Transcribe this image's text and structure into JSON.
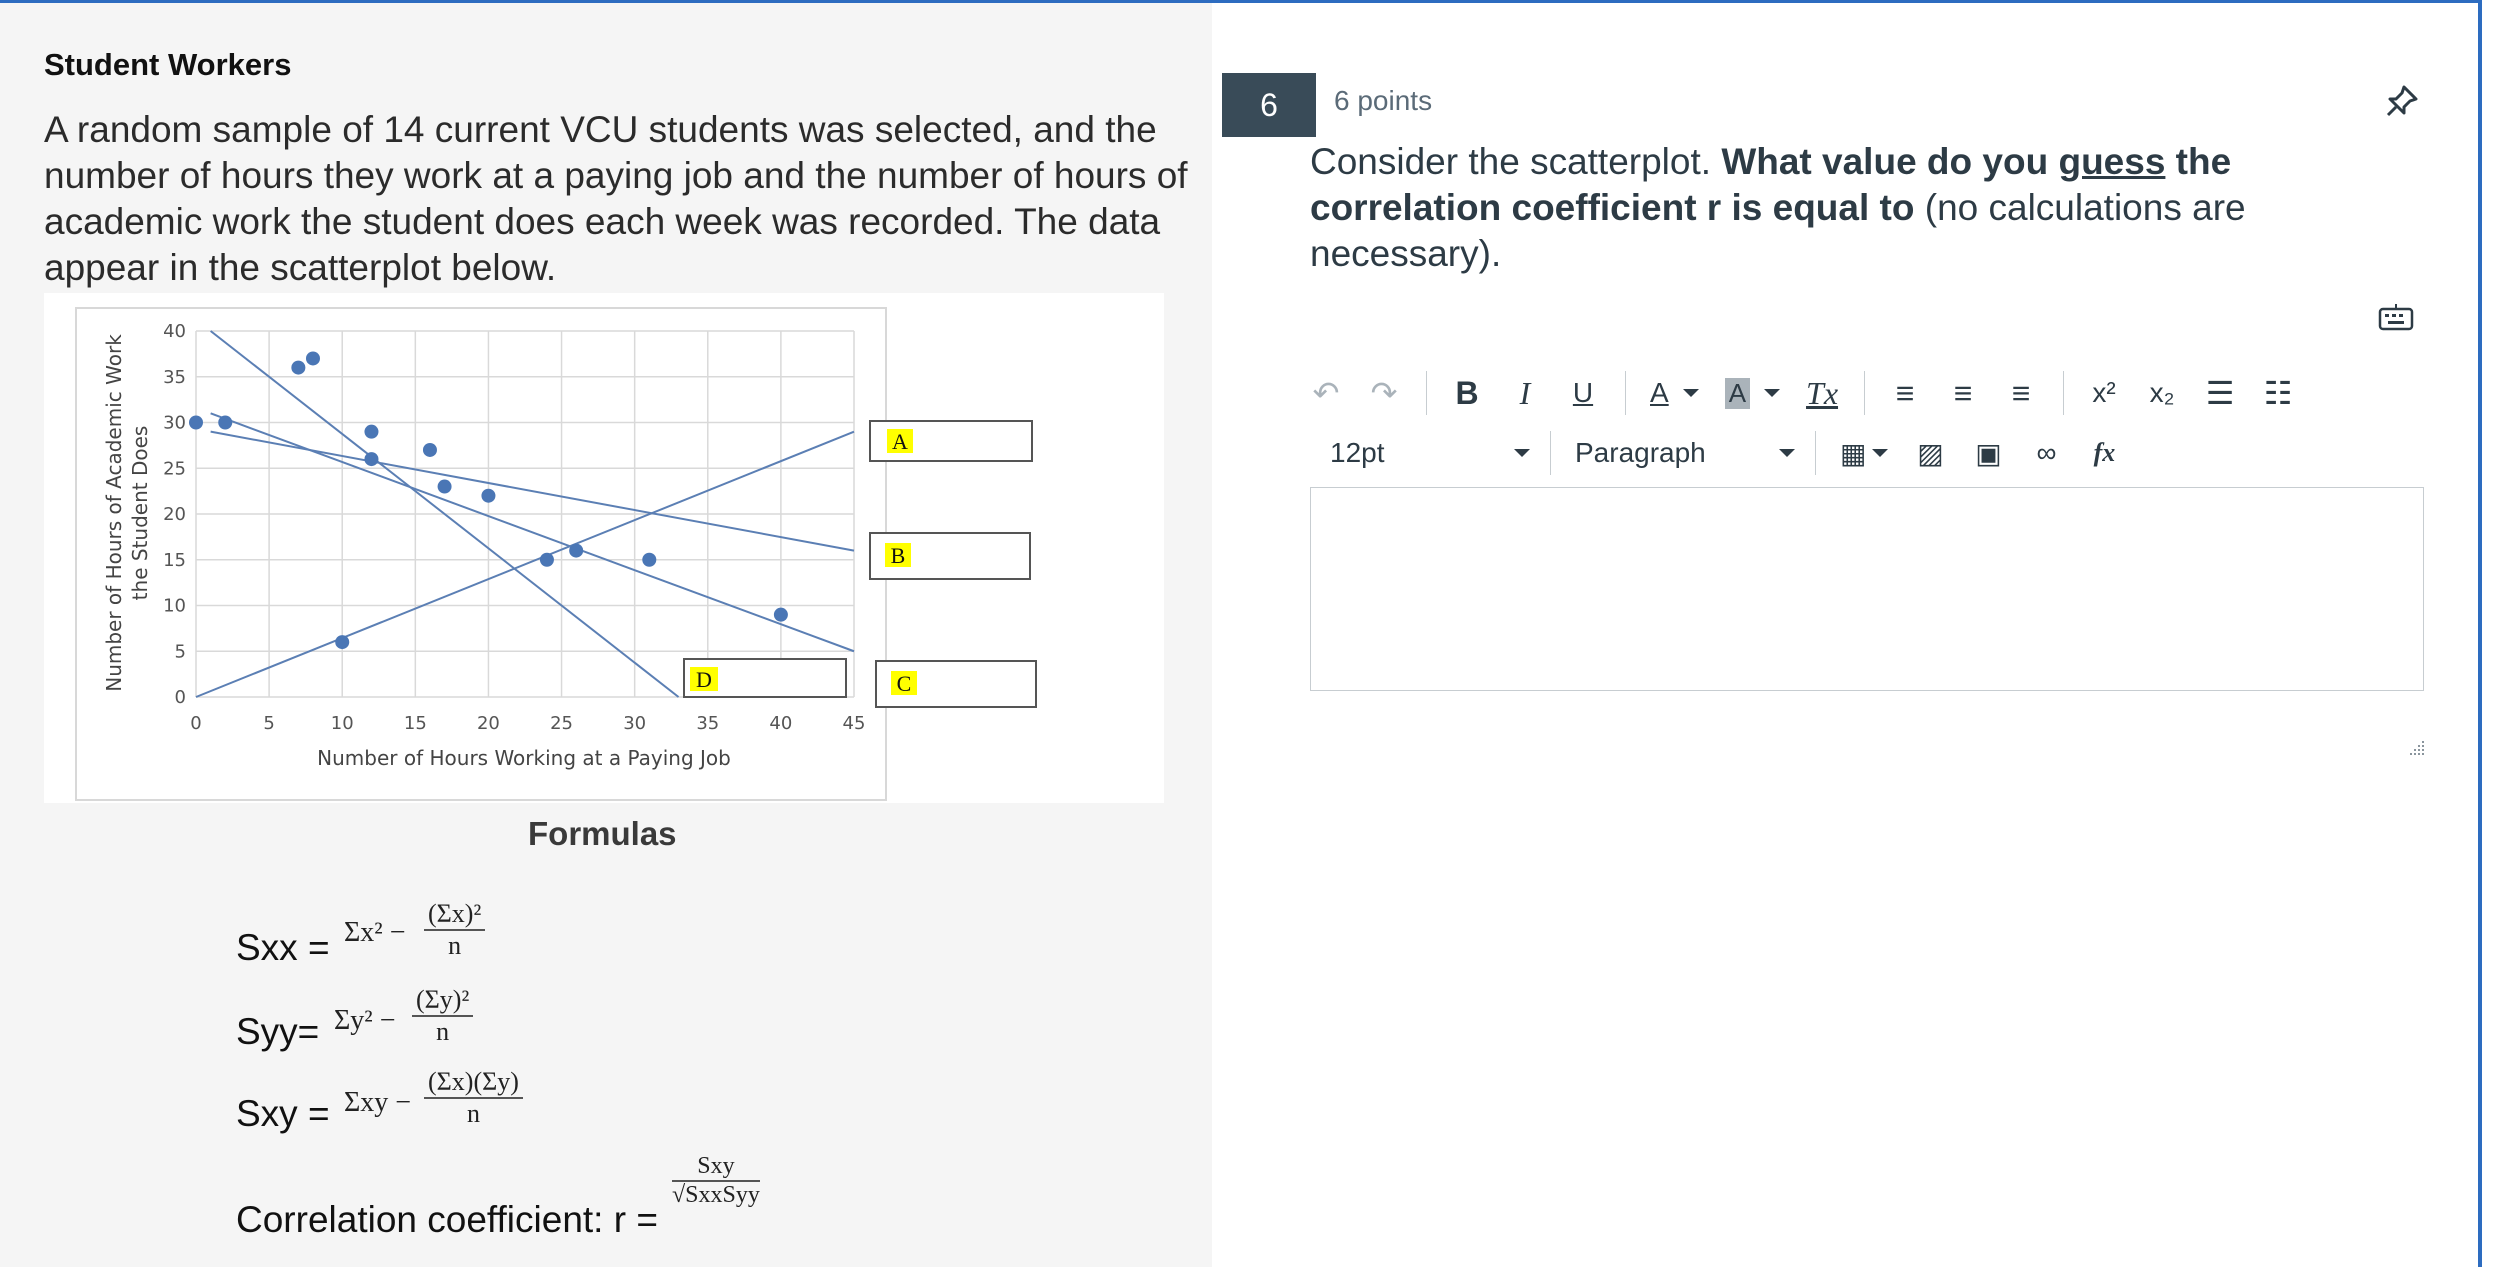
{
  "left": {
    "title": "Student Workers",
    "description": "A random sample of 14 current VCU students was selected, and the number of hours they work at a paying job and the number of hours of academic work the student does each week was recorded. The data appear in the scatterplot below.",
    "formulas_title": "Formulas",
    "formula_labels": {
      "sxx": "Sxx =",
      "syy": "Syy=",
      "sxy": "Sxy =",
      "corr": "Correlation coefficient: r ="
    },
    "formula_parts": {
      "sxx_sum": "Σx² −",
      "sxx_num": "(Σx)²",
      "sxx_den": "n",
      "syy_sum": "Σy² −",
      "syy_num": "(Σy)²",
      "syy_den": "n",
      "sxy_sum": "Σxy −",
      "sxy_num": "(Σx)(Σy)",
      "sxy_den": "n",
      "r_num": "Sxy",
      "r_den": "√SxxSyy"
    }
  },
  "chart_data": {
    "type": "scatter",
    "xlabel": "Number of Hours Working at a Paying Job",
    "ylabel_line1": "Number of Hours of Academic Work",
    "ylabel_line2": "the Student Does",
    "xlim": [
      0,
      45
    ],
    "ylim": [
      0,
      40
    ],
    "xticks": [
      0,
      5,
      10,
      15,
      20,
      25,
      30,
      35,
      40,
      45
    ],
    "yticks": [
      0,
      5,
      10,
      15,
      20,
      25,
      30,
      35,
      40
    ],
    "grid": true,
    "points": [
      {
        "x": 0,
        "y": 30
      },
      {
        "x": 2,
        "y": 30
      },
      {
        "x": 7,
        "y": 36
      },
      {
        "x": 8,
        "y": 37
      },
      {
        "x": 10,
        "y": 6
      },
      {
        "x": 12,
        "y": 29
      },
      {
        "x": 12,
        "y": 26
      },
      {
        "x": 16,
        "y": 27
      },
      {
        "x": 17,
        "y": 23
      },
      {
        "x": 20,
        "y": 22
      },
      {
        "x": 24,
        "y": 15
      },
      {
        "x": 26,
        "y": 16
      },
      {
        "x": 31,
        "y": 15
      },
      {
        "x": 40,
        "y": 9
      }
    ],
    "lines": [
      {
        "label": "A",
        "x1": 0,
        "y1": 0,
        "x2": 45,
        "y2": 29
      },
      {
        "label": "B",
        "x1": 1,
        "y1": 29,
        "x2": 45,
        "y2": 16
      },
      {
        "label": "C",
        "x1": 1,
        "y1": 31,
        "x2": 45,
        "y2": 5
      },
      {
        "label": "D",
        "x1": 1,
        "y1": 40,
        "x2": 33,
        "y2": 0
      }
    ],
    "tags": [
      "A",
      "B",
      "C",
      "D"
    ]
  },
  "question": {
    "number": "6",
    "points": "6 points",
    "text_part1": "Consider the scatterplot. ",
    "text_bold1": "What value do you ",
    "text_bold_underline": "guess",
    "text_bold2": " the correlation coefficient r is equal to",
    "text_part2": " (no calculations are necessary)."
  },
  "toolbar": {
    "font_size": "12pt",
    "block_format": "Paragraph",
    "buttons": [
      "undo-icon",
      "redo-icon",
      "bold-icon",
      "italic-icon",
      "underline-icon",
      "text-color-icon",
      "background-color-icon",
      "clear-formatting-icon",
      "align-left-icon",
      "align-center-icon",
      "align-right-icon",
      "superscript-icon",
      "subscript-icon",
      "bullet-list-icon",
      "numbered-list-icon",
      "table-icon",
      "image-icon",
      "media-icon",
      "link-icon",
      "equation-icon"
    ]
  },
  "colors": {
    "accent": "#2d6cc0",
    "dot": "#4a76b5",
    "tag_bg": "#ffff00",
    "qnum_bg": "#394b58"
  }
}
